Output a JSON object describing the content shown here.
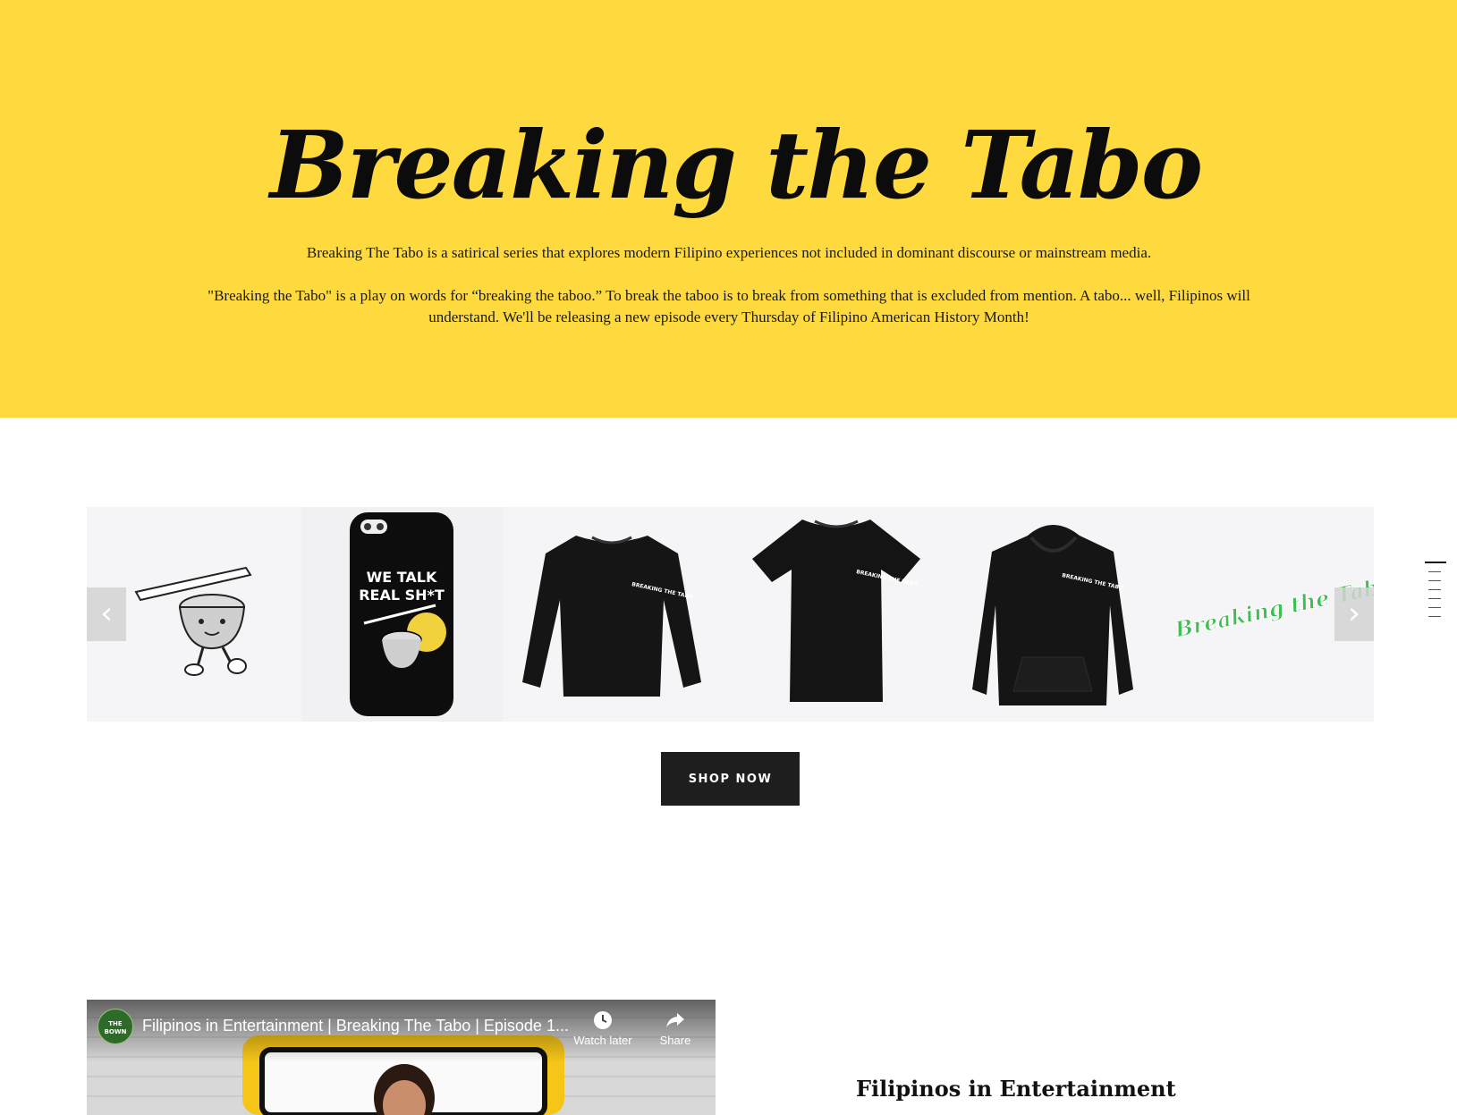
{
  "hero": {
    "title": "Breaking the Tabo",
    "description_1": "Breaking The Tabo is a satirical series that explores modern Filipino experiences not included in dominant discourse or mainstream media.",
    "description_2": "\"Breaking the Tabo\" is a play on words for “breaking the taboo.” To break the taboo is to break from something that is excluded from mention. A tabo... well, Filipinos will understand. We'll be releasing a new episode every Thursday of Filipino American History Month!",
    "background_color": "#ffda3f"
  },
  "merch_carousel": {
    "phone_case_text_1": "WE TALK",
    "phone_case_text_2": "REAL SH*T",
    "shirt_print": "BREAKING THE TABO",
    "sticker_text": "Breaking the Tabo",
    "prev_icon": "chevron-left-icon",
    "next_icon": "chevron-right-icon"
  },
  "shop": {
    "button_label": "SHOP NOW"
  },
  "side_nav": {
    "count": 7,
    "active_index": 0
  },
  "video": {
    "channel_avatar": "THE BOWN",
    "title": "Filipinos in Entertainment | Breaking The Tabo | Episode 1...",
    "watch_later_label": "Watch later",
    "share_label": "Share"
  },
  "episode": {
    "title": "Filipinos in Entertainment"
  }
}
